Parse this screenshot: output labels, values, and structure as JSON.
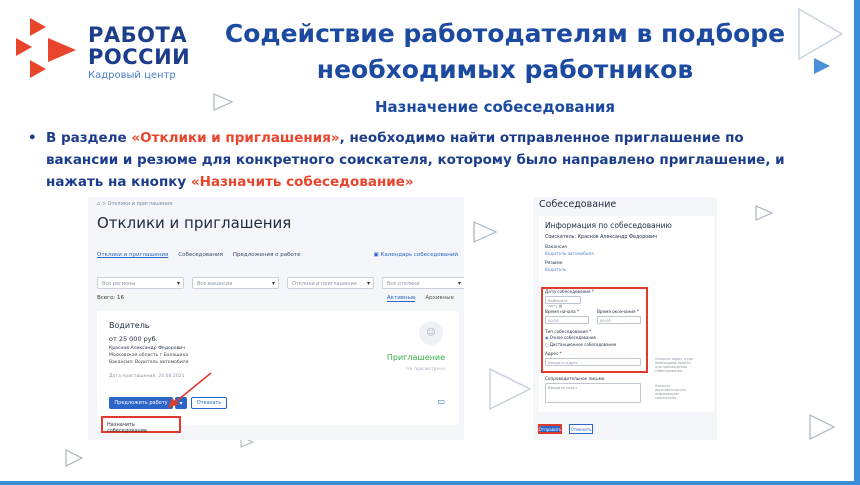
{
  "logo": {
    "line1": "РАБОТА",
    "line2": "РОССИИ",
    "line3": "Кадровый центр"
  },
  "title": "Содействие  работодателям в подборе необходимых работников",
  "subtitle": "Назначение собеседования",
  "bullet": {
    "p1": "В разделе ",
    "r1": "«Отклики и приглашения»",
    "p2": ", необходимо найти отправленное приглашение по вакансии и резюме для конкретного соискателя, которому было направлено приглашение, и нажать на кнопку ",
    "r2": "«Назначить собеседование»"
  },
  "colors": {
    "accent": "#1c4aa0",
    "highlight": "#e8452c",
    "primary_button": "#2a65c7",
    "success": "#38b149",
    "frame": "#3b8fd9"
  },
  "left_screen": {
    "breadcrumb": "⌂ > Отклики и приглашения",
    "heading": "Отклики и приглашения",
    "tabs": [
      "Отклики и приглашения",
      "Собеседования",
      "Предложения о работе"
    ],
    "calendar_link": "Календарь собеседований",
    "filters": [
      "Все регионы",
      "Все вакансии",
      "Отклики и приглашения",
      "Все отклики"
    ],
    "total": "Всего: 16",
    "view_tabs": [
      "Активные",
      "Архивные"
    ],
    "card": {
      "position": "Водитель",
      "salary": "от 25 000 руб.",
      "name": "Краснов Александр Федорович",
      "region": "Московская область г Балашиха",
      "vacancy": "Вакансия: Водитель автомобиля",
      "date": "Дата приглашения: 24.06.2021",
      "status": "Приглашение",
      "status_sub": "Не просмотрено",
      "offer_button": "Предложить работу",
      "reject_button": "Отказать"
    },
    "menu_item": "Назначить собеседование"
  },
  "right_screen": {
    "heading": "Собеседование",
    "card_title": "Информация по собеседованию",
    "applicant": "Соискатель: Краснов Александр Федорович",
    "vacancy_label": "Вакансия",
    "vacancy_value": "Водитель автомобиля",
    "resume_label": "Резюме",
    "resume_value": "Водитель",
    "date_label": "Дата собеседования *",
    "date_placeholder": "Выберите дату",
    "start_label": "Время начала *",
    "start_value": "00:00",
    "end_label": "Время окончания *",
    "end_value": "00:00",
    "type_label": "Тип собеседования *",
    "type_option1": "Очное собеседование",
    "type_option2": "Дистанционное собеседование",
    "address_label": "Адрес *",
    "address_placeholder": "Введите адрес",
    "address_hint": "Укажите адрес, куда необходимо прийти для прохождения собеседования",
    "letter_label": "Сопроводительное письмо",
    "letter_placeholder": "Введите текст",
    "letter_hint": "Укажите дополнительную информацию соискателю",
    "send_button": "Отправить",
    "cancel_button": "Отменить"
  }
}
